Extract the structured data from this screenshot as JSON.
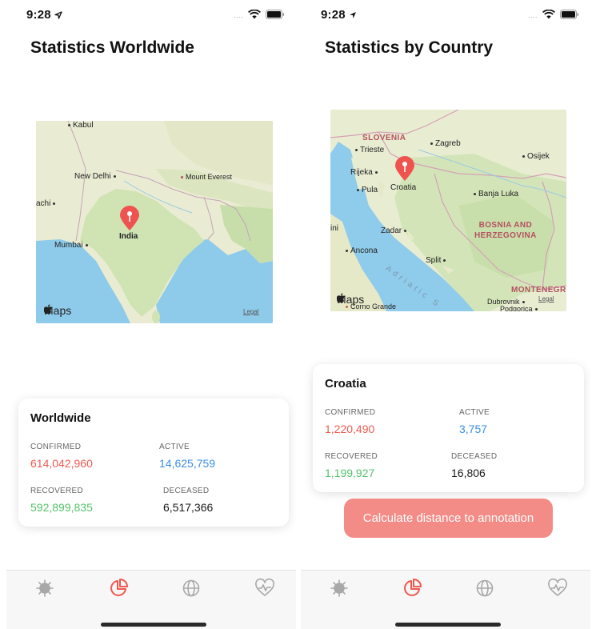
{
  "status_bar": {
    "time": "9:28",
    "signal_dots": "...."
  },
  "screens": {
    "worldwide": {
      "title": "Statistics Worldwide",
      "map": {
        "labels": {
          "kabul": "Kabul",
          "new_delhi": "New Delhi",
          "mount_everest": "Mount Everest",
          "achi": "achi",
          "mumbai": "Mumbai",
          "india": "India"
        },
        "maps_logo": "Maps",
        "legal": "Legal"
      },
      "card": {
        "title": "Worldwide",
        "confirmed_label": "CONFIRMED",
        "confirmed_value": "614,042,960",
        "active_label": "ACTIVE",
        "active_value": "14,625,759",
        "recovered_label": "RECOVERED",
        "recovered_value": "592,899,835",
        "deceased_label": "DECEASED",
        "deceased_value": "6,517,366"
      }
    },
    "country": {
      "title": "Statistics by Country",
      "map": {
        "labels": {
          "slovenia": "SLOVENIA",
          "trieste": "Trieste",
          "zagreb": "Zagreb",
          "osijek": "Osijek",
          "rijeka": "Rijeka",
          "pula": "Pula",
          "croatia": "Croatia",
          "banja_luka": "Banja Luka",
          "bosnia": "BOSNIA AND\nHERZEGOVINA",
          "ini": "ini",
          "zadar": "Zadar",
          "ancona": "Ancona",
          "split": "Split",
          "adriatic": "Adriatic S",
          "montenegro": "MONTENEGR",
          "corno_grande": "Corno Grande",
          "dubrovnik": "Dubrovnik",
          "podgorica": "Podgorica"
        },
        "maps_logo": "Maps",
        "legal": "Legal"
      },
      "card": {
        "title": "Croatia",
        "confirmed_label": "CONFIRMED",
        "confirmed_value": "1,220,490",
        "active_label": "ACTIVE",
        "active_value": "3,757",
        "recovered_label": "RECOVERED",
        "recovered_value": "1,199,927",
        "deceased_label": "DECEASED",
        "deceased_value": "16,806"
      },
      "button_label": "Calculate distance to annotation"
    }
  },
  "tab_bar": {
    "tabs": [
      {
        "icon": "virus-icon",
        "selected": false
      },
      {
        "icon": "pie-chart-icon",
        "selected": true
      },
      {
        "icon": "globe-icon",
        "selected": false
      },
      {
        "icon": "heart-pulse-icon",
        "selected": false
      }
    ]
  },
  "colors": {
    "accent": "#f0574f",
    "confirmed": "#ee5a52",
    "active": "#3a8ee6",
    "recovered": "#56c26b",
    "deceased": "#1a1a1a",
    "button_bg": "#f38b86",
    "tab_inactive": "#a8a8a8"
  }
}
